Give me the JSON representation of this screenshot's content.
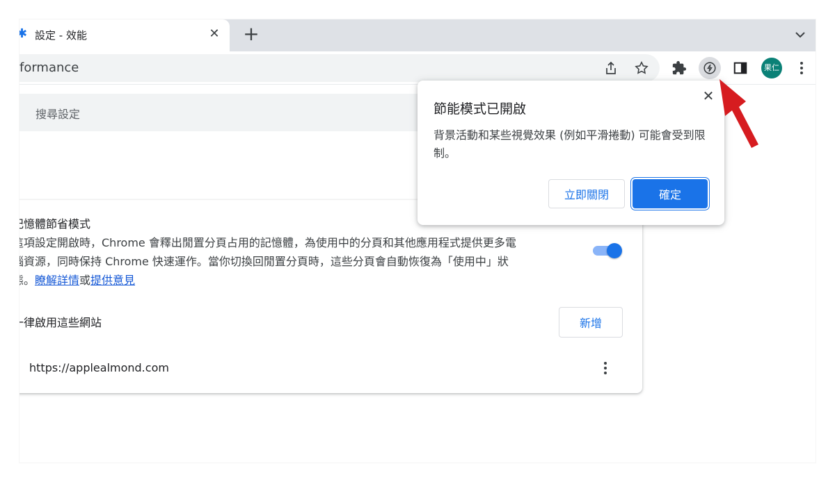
{
  "colors": {
    "accent": "#1a73e8",
    "avatar_bg": "#0b8177",
    "annotation_arrow": "#d61c20"
  },
  "tab": {
    "title": "設定 - 效能",
    "icon": "settings-gear-icon",
    "close_symbol": "✕",
    "new_tab_symbol": "+"
  },
  "toolbar": {
    "url": "formance",
    "icons": [
      "share-icon",
      "bookmark-star-icon",
      "extensions-icon",
      "performance-icon",
      "side-panel-icon",
      "menu-icon"
    ],
    "avatar_label": "果仁"
  },
  "settings": {
    "search_placeholder": "搜尋設定",
    "memory_saver": {
      "title": "記憶體節省模式",
      "description_line1": "這項設定開啟時，Chrome 會釋出閒置分頁占用的記憶體，為使用中的分頁和其他應用程式提供更多電",
      "description_line2": "腦資源，同時保持 Chrome 快速運作。當你切換回閒置分頁時，這些分頁會自動恢復為「使用中」狀",
      "description_line3_prefix": "態。",
      "learn_more_link": "瞭解詳情",
      "or_text": "或",
      "feedback_link": "提供意見",
      "enabled": true
    },
    "always_active_sites_label": "一律啟用這些網站",
    "add_button": "新增",
    "sites": [
      "https://applealmond.com"
    ]
  },
  "popup": {
    "title": "節能模式已開啟",
    "body": "背景活動和某些視覺效果 (例如平滑捲動) 可能會受到限制。",
    "close_symbol": "✕",
    "turn_off_button": "立即關閉",
    "confirm_button": "確定"
  }
}
